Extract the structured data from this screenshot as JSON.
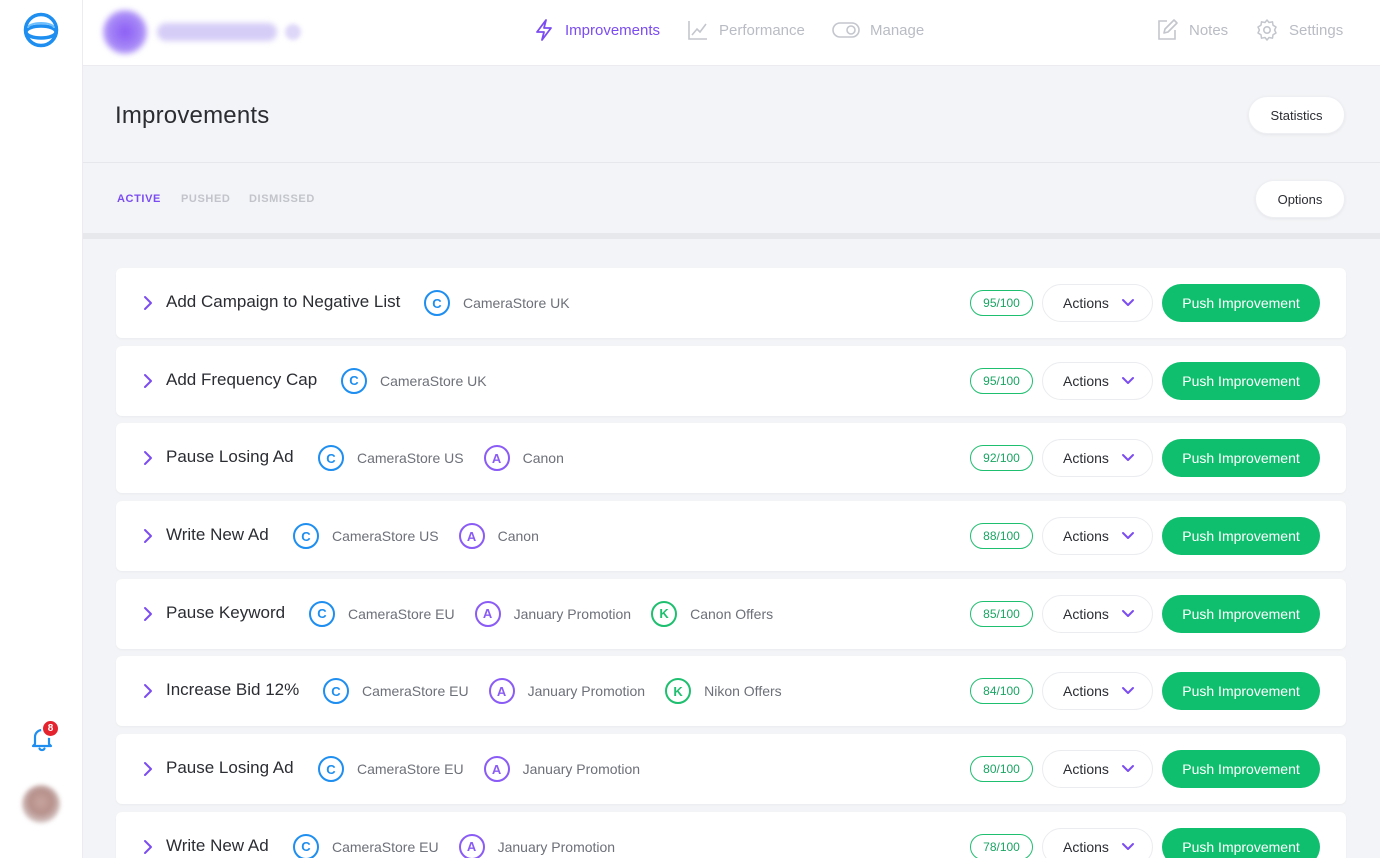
{
  "colors": {
    "accent": "#7b4cf1",
    "success": "#0fbf6e",
    "campaign": "#1e8ef0",
    "adgroup": "#8a5cf5",
    "keyword": "#1fbf70",
    "alert": "#e5232f"
  },
  "sidebar": {
    "notification_count": "8"
  },
  "topnav": {
    "items": [
      {
        "label": "Improvements",
        "icon": "lightning-icon",
        "active": true
      },
      {
        "label": "Performance",
        "icon": "line-chart-icon",
        "active": false
      },
      {
        "label": "Manage",
        "icon": "toggle-icon",
        "active": false
      }
    ],
    "right": [
      {
        "label": "Notes",
        "icon": "edit-icon"
      },
      {
        "label": "Settings",
        "icon": "gear-icon"
      }
    ]
  },
  "header": {
    "title": "Improvements",
    "statistics_label": "Statistics"
  },
  "tabs": {
    "items": [
      "ACTIVE",
      "PUSHED",
      "DISMISSED"
    ],
    "active": "ACTIVE",
    "options_label": "Options"
  },
  "improvements": [
    {
      "title": "Add Campaign to Negative List",
      "tags": [
        {
          "type": "C",
          "label": "CameraStore UK"
        }
      ],
      "score": "95/100"
    },
    {
      "title": "Add Frequency Cap",
      "tags": [
        {
          "type": "C",
          "label": "CameraStore UK"
        }
      ],
      "score": "95/100"
    },
    {
      "title": "Pause Losing Ad",
      "tags": [
        {
          "type": "C",
          "label": "CameraStore US"
        },
        {
          "type": "A",
          "label": "Canon"
        }
      ],
      "score": "92/100"
    },
    {
      "title": "Write New Ad",
      "tags": [
        {
          "type": "C",
          "label": "CameraStore US"
        },
        {
          "type": "A",
          "label": "Canon"
        }
      ],
      "score": "88/100"
    },
    {
      "title": "Pause Keyword",
      "tags": [
        {
          "type": "C",
          "label": "CameraStore EU"
        },
        {
          "type": "A",
          "label": "January Promotion"
        },
        {
          "type": "K",
          "label": "Canon Offers"
        }
      ],
      "score": "85/100"
    },
    {
      "title": "Increase Bid 12%",
      "tags": [
        {
          "type": "C",
          "label": "CameraStore EU"
        },
        {
          "type": "A",
          "label": "January Promotion"
        },
        {
          "type": "K",
          "label": "Nikon Offers"
        }
      ],
      "score": "84/100"
    },
    {
      "title": "Pause Losing Ad",
      "tags": [
        {
          "type": "C",
          "label": "CameraStore EU"
        },
        {
          "type": "A",
          "label": "January Promotion"
        }
      ],
      "score": "80/100"
    },
    {
      "title": "Write New Ad",
      "tags": [
        {
          "type": "C",
          "label": "CameraStore EU"
        },
        {
          "type": "A",
          "label": "January Promotion"
        }
      ],
      "score": "78/100"
    }
  ],
  "row_actions": {
    "actions_label": "Actions",
    "push_label": "Push Improvement"
  }
}
